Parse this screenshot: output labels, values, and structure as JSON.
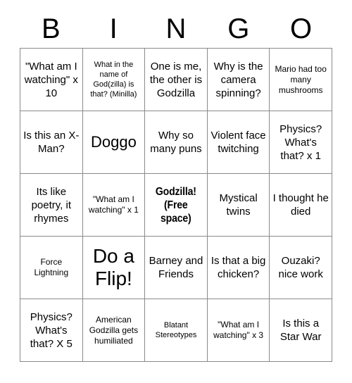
{
  "card": {
    "title": "BINGO",
    "header_letters": [
      "B",
      "I",
      "N",
      "G",
      "O"
    ],
    "grid_size": "5x5",
    "border_color": "#8a8a8a",
    "text_color": "#000000",
    "background_color": "#ffffff"
  },
  "cells": [
    {
      "id": "b1",
      "column": "B",
      "row": 1,
      "text": "\"What am I watching\" x 10",
      "size": "sz-md",
      "free_space": false
    },
    {
      "id": "i1",
      "column": "I",
      "row": 1,
      "text": "What in the name of God(zilla) is that? (Minilla)",
      "size": "sz-xs",
      "free_space": false
    },
    {
      "id": "n1",
      "column": "N",
      "row": 1,
      "text": "One is me, the other is Godzilla",
      "size": "sz-md",
      "free_space": false
    },
    {
      "id": "g1",
      "column": "G",
      "row": 1,
      "text": "Why is the camera spinning?",
      "size": "sz-md",
      "free_space": false
    },
    {
      "id": "o1",
      "column": "O",
      "row": 1,
      "text": "Mario had too many mushrooms",
      "size": "sz-sm",
      "free_space": false
    },
    {
      "id": "b2",
      "column": "B",
      "row": 2,
      "text": "Is this an X-Man?",
      "size": "sz-md",
      "free_space": false
    },
    {
      "id": "i2",
      "column": "I",
      "row": 2,
      "text": "Doggo",
      "size": "sz-lg",
      "free_space": false
    },
    {
      "id": "n2",
      "column": "N",
      "row": 2,
      "text": "Why so many puns",
      "size": "sz-md",
      "free_space": false
    },
    {
      "id": "g2",
      "column": "G",
      "row": 2,
      "text": "Violent face twitching",
      "size": "sz-md",
      "free_space": false
    },
    {
      "id": "o2",
      "column": "O",
      "row": 2,
      "text": "Physics? What's that? x 1",
      "size": "sz-md",
      "free_space": false
    },
    {
      "id": "b3",
      "column": "B",
      "row": 3,
      "text": "Its like poetry, it rhymes",
      "size": "sz-md",
      "free_space": false
    },
    {
      "id": "i3",
      "column": "I",
      "row": 3,
      "text": "\"What am I watching\" x 1",
      "size": "sz-sm",
      "free_space": false
    },
    {
      "id": "n3",
      "column": "N",
      "row": 3,
      "text": "Godzilla! (Free space)",
      "size": "free-space",
      "free_space": true
    },
    {
      "id": "g3",
      "column": "G",
      "row": 3,
      "text": "Mystical twins",
      "size": "sz-md",
      "free_space": false
    },
    {
      "id": "o3",
      "column": "O",
      "row": 3,
      "text": "I thought he died",
      "size": "sz-md",
      "free_space": false
    },
    {
      "id": "b4",
      "column": "B",
      "row": 4,
      "text": "Force Lightning",
      "size": "sz-sm",
      "free_space": false
    },
    {
      "id": "i4",
      "column": "I",
      "row": 4,
      "text": "Do a Flip!",
      "size": "sz-xl",
      "free_space": false
    },
    {
      "id": "n4",
      "column": "N",
      "row": 4,
      "text": "Barney and Friends",
      "size": "sz-md",
      "free_space": false
    },
    {
      "id": "g4",
      "column": "G",
      "row": 4,
      "text": "Is that a big chicken?",
      "size": "sz-md",
      "free_space": false
    },
    {
      "id": "o4",
      "column": "O",
      "row": 4,
      "text": "Ouzaki? nice work",
      "size": "sz-md",
      "free_space": false
    },
    {
      "id": "b5",
      "column": "B",
      "row": 5,
      "text": "Physics? What's that? X 5",
      "size": "sz-md",
      "free_space": false
    },
    {
      "id": "i5",
      "column": "I",
      "row": 5,
      "text": "American Godzilla gets humiliated",
      "size": "sz-sm",
      "free_space": false
    },
    {
      "id": "n5",
      "column": "N",
      "row": 5,
      "text": "Blatant Stereotypes",
      "size": "sz-xs",
      "free_space": false
    },
    {
      "id": "g5",
      "column": "G",
      "row": 5,
      "text": "\"What am I watching\" x 3",
      "size": "sz-sm",
      "free_space": false
    },
    {
      "id": "o5",
      "column": "O",
      "row": 5,
      "text": "Is this a Star War",
      "size": "sz-md",
      "free_space": false
    }
  ]
}
